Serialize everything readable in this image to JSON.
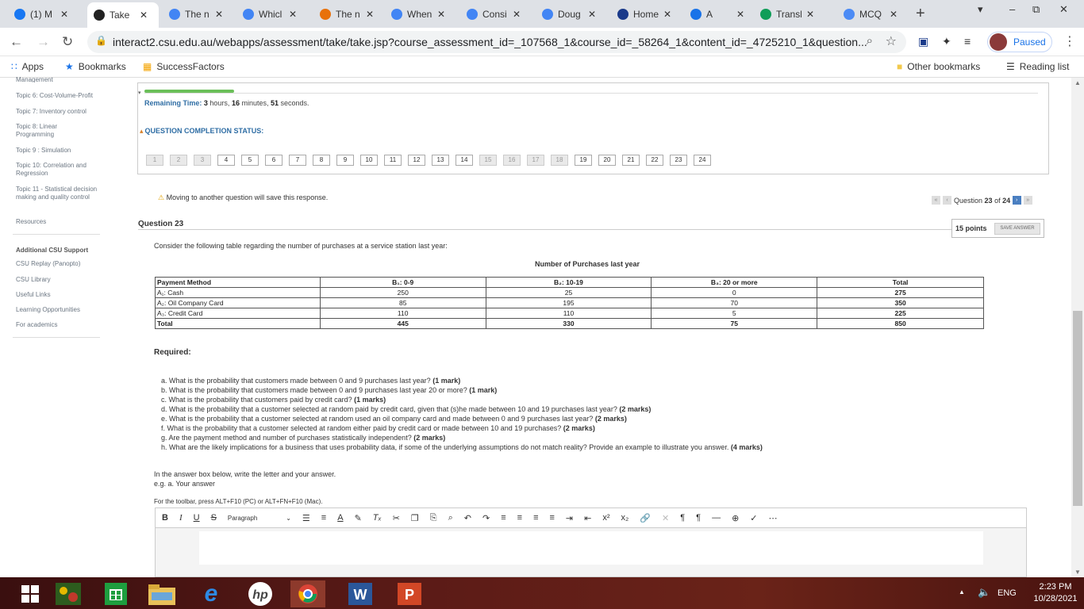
{
  "browser": {
    "tabs": [
      {
        "title": "(1) M",
        "icon": "facebook-icon",
        "color": "#1877f2"
      },
      {
        "title": "Take",
        "icon": "blackboard-icon",
        "color": "#222",
        "active": true
      },
      {
        "title": "The n",
        "icon": "google-icon",
        "color": "#4285f4"
      },
      {
        "title": "Whicl",
        "icon": "google-icon",
        "color": "#4285f4"
      },
      {
        "title": "The n",
        "icon": "video-icon",
        "color": "#e8710a"
      },
      {
        "title": "When",
        "icon": "google-icon",
        "color": "#4285f4"
      },
      {
        "title": "Consi",
        "icon": "google-icon",
        "color": "#4285f4"
      },
      {
        "title": "Doug",
        "icon": "google-icon",
        "color": "#4285f4"
      },
      {
        "title": "Home",
        "icon": "star-icon",
        "color": "#1a3a8a"
      },
      {
        "title": "A",
        "icon": "meet-icon",
        "color": "#1a73e8"
      },
      {
        "title": "Transl",
        "icon": "translate-icon",
        "color": "#0f9d58"
      },
      {
        "title": "MCQ",
        "icon": "s-icon",
        "color": "#4c8bf5"
      }
    ],
    "new_tab": "+",
    "url": "interact2.csu.edu.au/webapps/assessment/take/take.jsp?course_assessment_id=_107568_1&course_id=_58264_1&content_id=_4725210_1&question...",
    "profile_label": "Paused",
    "bookmarks": {
      "apps": "Apps",
      "bookmarks": "Bookmarks",
      "successfactors": "SuccessFactors",
      "other": "Other bookmarks",
      "reading_list": "Reading list"
    }
  },
  "sidebar": {
    "cut_item": "Management",
    "items": [
      "Topic 6: Cost-Volume-Profit",
      "Topic 7: Inventory control",
      "Topic 8: Linear Programming",
      "Topic 9 : Simulation",
      "Topic 10: Correlation and Regression",
      "Topic 11 - Statistical decision making and quality control",
      "Resources"
    ],
    "support_heading": "Additional CSU Support",
    "support_items": [
      "CSU Replay (Panopto)",
      "CSU Library",
      "Useful Links",
      "Learning Opportunities",
      "For academics"
    ]
  },
  "status": {
    "progress_percent": 10,
    "remaining_label": "Remaining Time:",
    "hours": "3",
    "hours_label": "hours,",
    "minutes": "16",
    "minutes_label": "minutes,",
    "seconds": "51",
    "seconds_label": "seconds.",
    "completion_heading": "QUESTION COMPLETION STATUS:",
    "questions": [
      {
        "n": "1",
        "done": true
      },
      {
        "n": "2",
        "done": true
      },
      {
        "n": "3",
        "done": true
      },
      {
        "n": "4"
      },
      {
        "n": "5"
      },
      {
        "n": "6"
      },
      {
        "n": "7"
      },
      {
        "n": "8"
      },
      {
        "n": "9"
      },
      {
        "n": "10"
      },
      {
        "n": "11"
      },
      {
        "n": "12"
      },
      {
        "n": "13"
      },
      {
        "n": "14"
      },
      {
        "n": "15",
        "done": true
      },
      {
        "n": "16",
        "done": true
      },
      {
        "n": "17",
        "done": true
      },
      {
        "n": "18",
        "done": true
      },
      {
        "n": "19"
      },
      {
        "n": "20"
      },
      {
        "n": "21"
      },
      {
        "n": "22"
      },
      {
        "n": "23"
      },
      {
        "n": "24"
      }
    ]
  },
  "question": {
    "warning": "Moving to another question will save this response.",
    "nav_label": "Question",
    "current": "23",
    "of_label": "of",
    "total": "24",
    "title": "Question 23",
    "points": "15 points",
    "save_answer": "SAVE ANSWER",
    "intro": "Consider the following table regarding the number of purchases at a service station last year:",
    "table_caption": "Number of Purchases last year",
    "table": {
      "headers": [
        "Payment Method",
        "B₁: 0-9",
        "B₂: 10-19",
        "B₃: 20 or more",
        "Total"
      ],
      "rows": [
        [
          "A₁: Cash",
          "250",
          "25",
          "0",
          "275"
        ],
        [
          "A₂: Oil Company Card",
          "85",
          "195",
          "70",
          "350"
        ],
        [
          "A₃: Credit Card",
          "110",
          "110",
          "5",
          "225"
        ],
        [
          "Total",
          "445",
          "330",
          "75",
          "850"
        ]
      ]
    },
    "required": "Required:",
    "parts": [
      {
        "text": "a. What is the probability that customers made between 0 and 9 purchases last year?",
        "marks": "(1 mark)"
      },
      {
        "text": "b. What is the probability that customers made between 0 and 9 purchases last year 20 or more?",
        "marks": "(1 mark)"
      },
      {
        "text": "c. What is the probability that customers paid by credit card?",
        "marks": "(1 marks)"
      },
      {
        "text": "d. What is the probability that a customer selected at random paid by credit card, given that (s)he made between 10 and 19 purchases last year?",
        "marks": "(2 marks)"
      },
      {
        "text": "e. What is the probability that a customer selected at random used an oil company card and made between 0 and 9 purchases last year?",
        "marks": "(2 marks)"
      },
      {
        "text": "f. What is the probability that a customer selected at random either paid by credit card or made between 10 and 19 purchases?",
        "marks": "(2 marks)"
      },
      {
        "text": "g. Are the payment method and number of purchases statistically independent?",
        "marks": "(2 marks)"
      },
      {
        "text": "h. What are the likely implications for a business that uses probability data, if some of the underlying assumptions do not match reality? Provide an example to illustrate you answer.",
        "marks": "(4 marks)"
      }
    ],
    "instruction_1": "In the answer box below, write the letter and your answer.",
    "instruction_2": "e.g. a. Your answer",
    "toolbar_hint": "For the toolbar, press ALT+F10 (PC) or ALT+FN+F10 (Mac).",
    "paragraph_select": "Paragraph"
  },
  "taskbar": {
    "language": "ENG",
    "time": "2:23 PM",
    "date": "10/28/2021"
  }
}
